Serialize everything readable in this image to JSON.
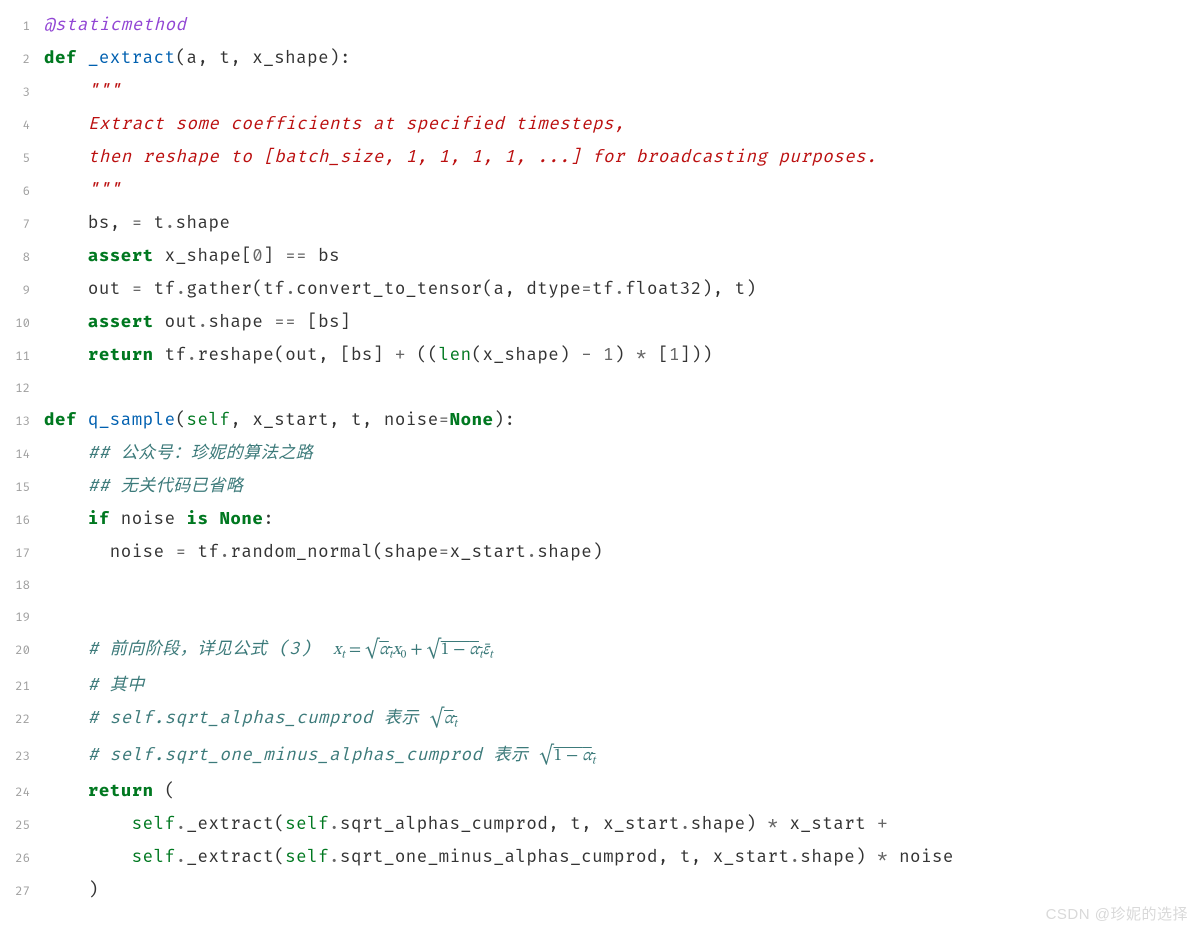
{
  "lines": {
    "l1": {
      "no": "1",
      "decorator": "@staticmethod"
    },
    "l2": {
      "no": "2",
      "kw_def": "def",
      "fname": "_extract",
      "params": "(a, t, x_shape):"
    },
    "l3": {
      "no": "3",
      "doc": "\"\"\""
    },
    "l4": {
      "no": "4",
      "doc": "Extract some coefficients at specified timesteps,"
    },
    "l5": {
      "no": "5",
      "doc": "then reshape to [batch_size, 1, 1, 1, 1, ...] for broadcasting purposes."
    },
    "l6": {
      "no": "6",
      "doc": "\"\"\""
    },
    "l7": {
      "no": "7",
      "text_a": "bs, ",
      "op_eq": "=",
      "text_b": " t",
      "op_dot": ".",
      "text_c": "shape"
    },
    "l8": {
      "no": "8",
      "kw": "assert",
      "text_a": " x_shape[",
      "num0": "0",
      "text_b": "] ",
      "op": "==",
      "text_c": " bs"
    },
    "l9": {
      "no": "9",
      "text_a": "out ",
      "op_eq": "=",
      "text_b": " tf",
      "op_d1": ".",
      "text_c": "gather(tf",
      "op_d2": ".",
      "text_d": "convert_to_tensor(a, dtype",
      "op_eq2": "=",
      "text_e": "tf",
      "op_d3": ".",
      "text_f": "float32), t)"
    },
    "l10": {
      "no": "10",
      "kw": "assert",
      "text_a": " out",
      "op_d": ".",
      "text_b": "shape ",
      "op": "==",
      "text_c": " [bs]"
    },
    "l11": {
      "no": "11",
      "kw": "return",
      "text_a": " tf",
      "op_d": ".",
      "text_b": "reshape(out, [bs] ",
      "op_plus": "+",
      "text_c": " ((",
      "builtin": "len",
      "text_d": "(x_shape) ",
      "op_minus": "-",
      "text_e": " ",
      "num1": "1",
      "text_f": ") ",
      "op_star": "*",
      "text_g": " [",
      "num1b": "1",
      "text_h": "]))"
    },
    "l12": {
      "no": "12"
    },
    "l13": {
      "no": "13",
      "kw_def": "def",
      "fname": "q_sample",
      "paren_o": "(",
      "self": "self",
      "params": ", x_start, t, noise",
      "op_eq": "=",
      "none": "None",
      "paren_c": "):"
    },
    "l14": {
      "no": "14",
      "comment": "## 公众号：珍妮的算法之路"
    },
    "l15": {
      "no": "15",
      "comment": "## 无关代码已省略"
    },
    "l16": {
      "no": "16",
      "kw_if": "if",
      "text_a": " noise ",
      "kw_is": "is",
      "text_b": " ",
      "none": "None",
      "colon": ":"
    },
    "l17": {
      "no": "17",
      "text_a": "noise ",
      "op_eq": "=",
      "text_b": " tf",
      "op_d": ".",
      "text_c": "random_normal(shape",
      "op_eq2": "=",
      "text_d": "x_start",
      "op_d2": ".",
      "text_e": "shape)"
    },
    "l18": {
      "no": "18"
    },
    "l19": {
      "no": "19"
    },
    "l20": {
      "no": "20",
      "comment_pre": "# 前向阶段，详见公式 (3)  "
    },
    "l21": {
      "no": "21",
      "comment": "# 其中"
    },
    "l22": {
      "no": "22",
      "comment_pre": "# self.sqrt_alphas_cumprod 表示 "
    },
    "l23": {
      "no": "23",
      "comment_pre": "# self.sqrt_one_minus_alphas_cumprod 表示 "
    },
    "l24": {
      "no": "24",
      "kw": "return",
      "text": " ("
    },
    "l25": {
      "no": "25",
      "self1": "self",
      "op_d1": ".",
      "text_a": "_extract(",
      "self2": "self",
      "op_d2": ".",
      "text_b": "sqrt_alphas_cumprod, t, x_start",
      "op_d3": ".",
      "text_c": "shape) ",
      "op_star": "*",
      "text_d": " x_start ",
      "op_plus": "+"
    },
    "l26": {
      "no": "26",
      "self1": "self",
      "op_d1": ".",
      "text_a": "_extract(",
      "self2": "self",
      "op_d2": ".",
      "text_b": "sqrt_one_minus_alphas_cumprod, t, x_start",
      "op_d3": ".",
      "text_c": "shape) ",
      "op_star": "*",
      "text_d": " noise"
    },
    "l27": {
      "no": "27",
      "text": ")"
    }
  },
  "math": {
    "l20": {
      "x": "x",
      "t": "t",
      "eq": " = ",
      "sqrt": "√",
      "alpha": "α",
      "x0": "x",
      "zero": "0",
      "plus": " + ",
      "one_minus": "1 − ",
      "eps": "ε̄"
    },
    "l22": {
      "sqrt": "√",
      "alpha": "α",
      "t": "t"
    },
    "l23": {
      "sqrt": "√",
      "one_minus": "1 − ",
      "alpha": "α",
      "t": "t"
    }
  },
  "watermark": "CSDN @珍妮的选择"
}
